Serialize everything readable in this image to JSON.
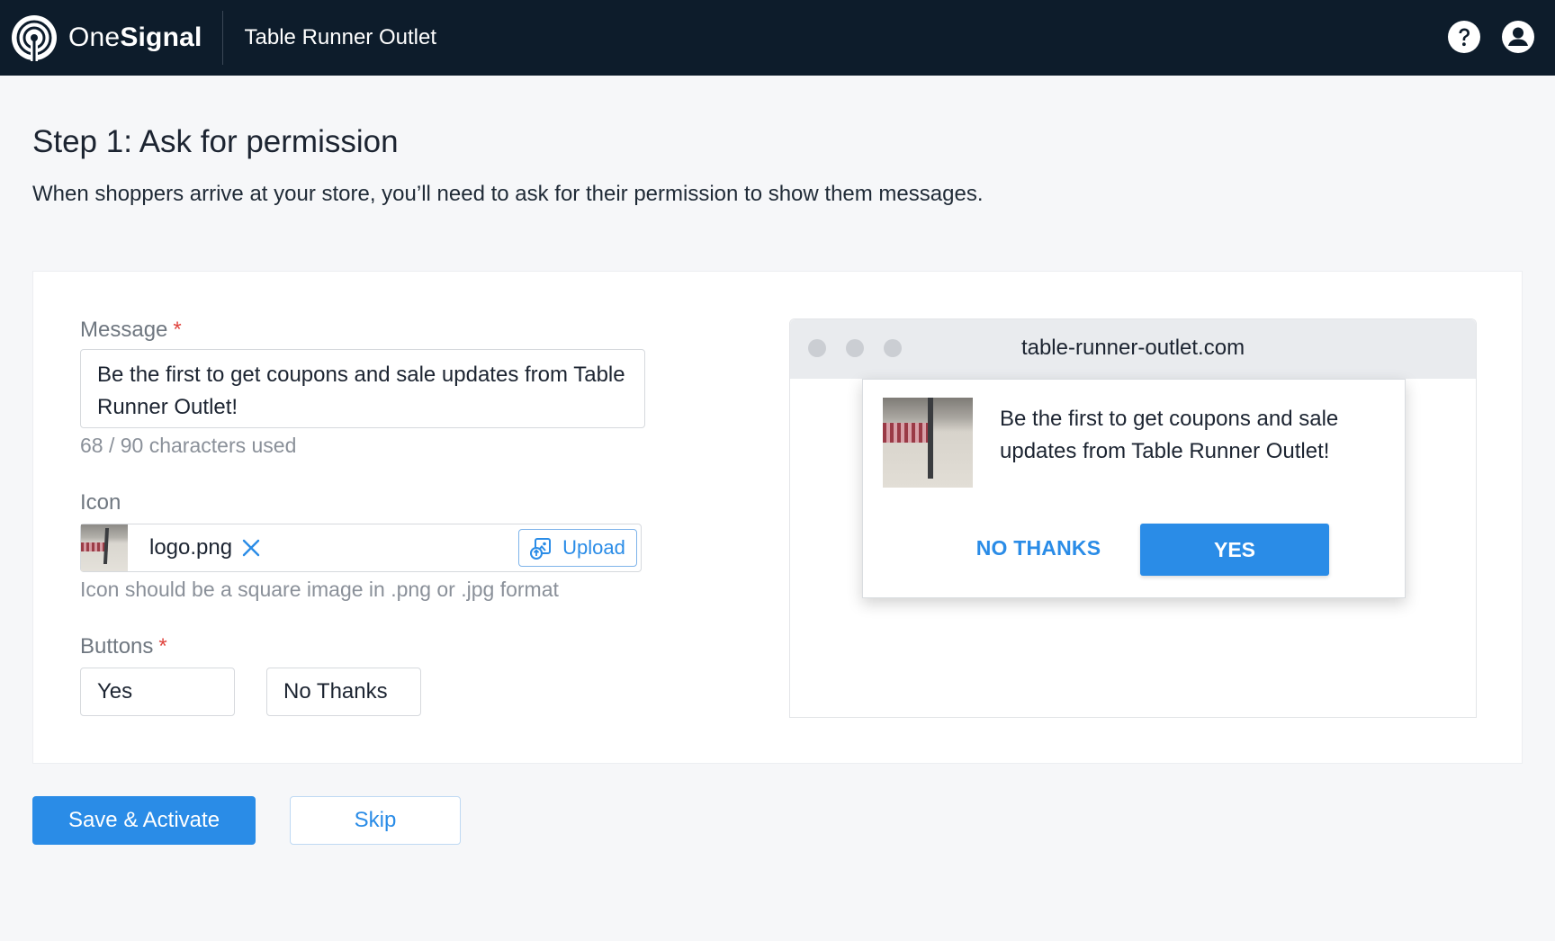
{
  "header": {
    "brand_word1": "One",
    "brand_word2": "Signal",
    "app_name": "Table Runner Outlet",
    "icons": [
      "help-icon",
      "account-icon"
    ]
  },
  "page": {
    "title": "Step 1: Ask for permission",
    "description": "When shoppers arrive at your store, you’ll need to ask for their permission to show them messages."
  },
  "form": {
    "message": {
      "label": "Message",
      "required_mark": "*",
      "value": "Be the first to get coupons and sale updates from Table Runner Outlet!",
      "helper": "68 / 90 characters used"
    },
    "icon": {
      "label": "Icon",
      "filename": "logo.png",
      "upload_label": "Upload",
      "helper": "Icon should be a square image in .png or .jpg format"
    },
    "buttons": {
      "label": "Buttons",
      "required_mark": "*",
      "accept_value": "Yes",
      "decline_value": "No Thanks"
    }
  },
  "preview": {
    "url": "table-runner-outlet.com",
    "prompt_text": "Be the first to get coupons and sale updates from Table Runner Outlet!",
    "decline_label": "NO THANKS",
    "accept_label": "YES"
  },
  "actions": {
    "save_label": "Save & Activate",
    "skip_label": "Skip"
  },
  "colors": {
    "header_bg": "#0d1c2b",
    "accent": "#2a8ce7",
    "required": "#e0453f"
  }
}
